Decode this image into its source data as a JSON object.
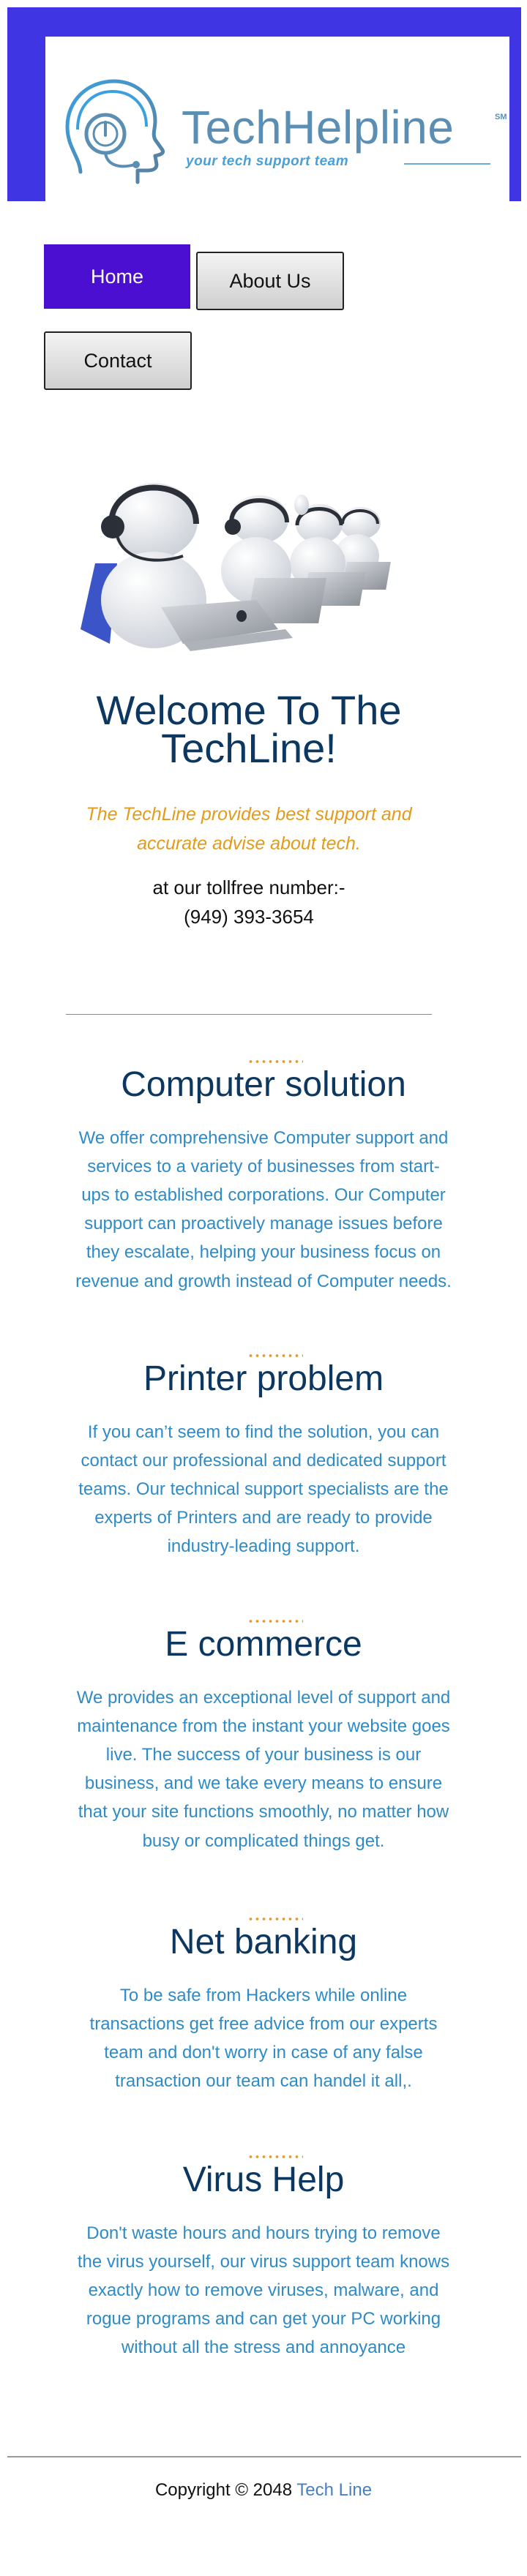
{
  "header": {
    "logo_title": "TechHelpline",
    "logo_sm": "SM",
    "logo_tagline": "your tech support team"
  },
  "nav": {
    "home": "Home",
    "about": "About Us",
    "contact": "Contact"
  },
  "welcome": {
    "line1": "Welcome To The",
    "line2": "TechLine!",
    "tagline_line1": "The TechLine provides best support and",
    "tagline_line2": "accurate advise about tech.",
    "toll_label": "at our tollfree number:-",
    "phone": "(949) 393-3654"
  },
  "sections": [
    {
      "title": "Computer solution",
      "lines": [
        "We offer comprehensive Computer support and",
        "services to a variety of businesses from start-",
        "ups to established corporations. Our Computer",
        "support can proactively manage issues before",
        "they escalate, helping your business focus on",
        "revenue and growth instead of Computer needs."
      ]
    },
    {
      "title": "Printer problem",
      "lines": [
        "If you can’t seem to find the solution, you can",
        "contact our professional and dedicated support",
        "teams. Our technical support specialists are the",
        "experts of Printers and are ready to provide",
        "industry-leading support."
      ]
    },
    {
      "title": "E commerce",
      "lines": [
        "We provides an exceptional level of support and",
        "maintenance from the instant your website goes",
        "live. The success of your business is our",
        "business, and we take every means to ensure",
        "that your site functions smoothly, no matter how",
        "busy or complicated things get."
      ]
    },
    {
      "title": "Net banking",
      "lines": [
        "To be safe from Hackers while online",
        "transactions get free advice from our experts",
        "team and don't worry in case of any false",
        "transaction our team can handel it all,."
      ]
    },
    {
      "title": "Virus Help",
      "lines": [
        "Don't waste hours and hours trying to remove",
        "the virus yourself, our virus support team knows",
        "exactly how to remove viruses, malware, and",
        "rogue programs and can get your PC working",
        "without all the stress and annoyance"
      ]
    }
  ],
  "footer": {
    "copyright": "Copyright © 2048 ",
    "brand": "Tech Line"
  },
  "colors": {
    "header_band": "#3f35e3",
    "nav_active": "#4a0fd1",
    "title": "#0c3760",
    "tagline": "#e39b1b",
    "body_text": "#2f8bc6",
    "footer_link": "#4a7fc0"
  },
  "icons": {
    "logo": "head-with-headset-icon",
    "hero": "support-agents-with-headsets-illustration"
  }
}
